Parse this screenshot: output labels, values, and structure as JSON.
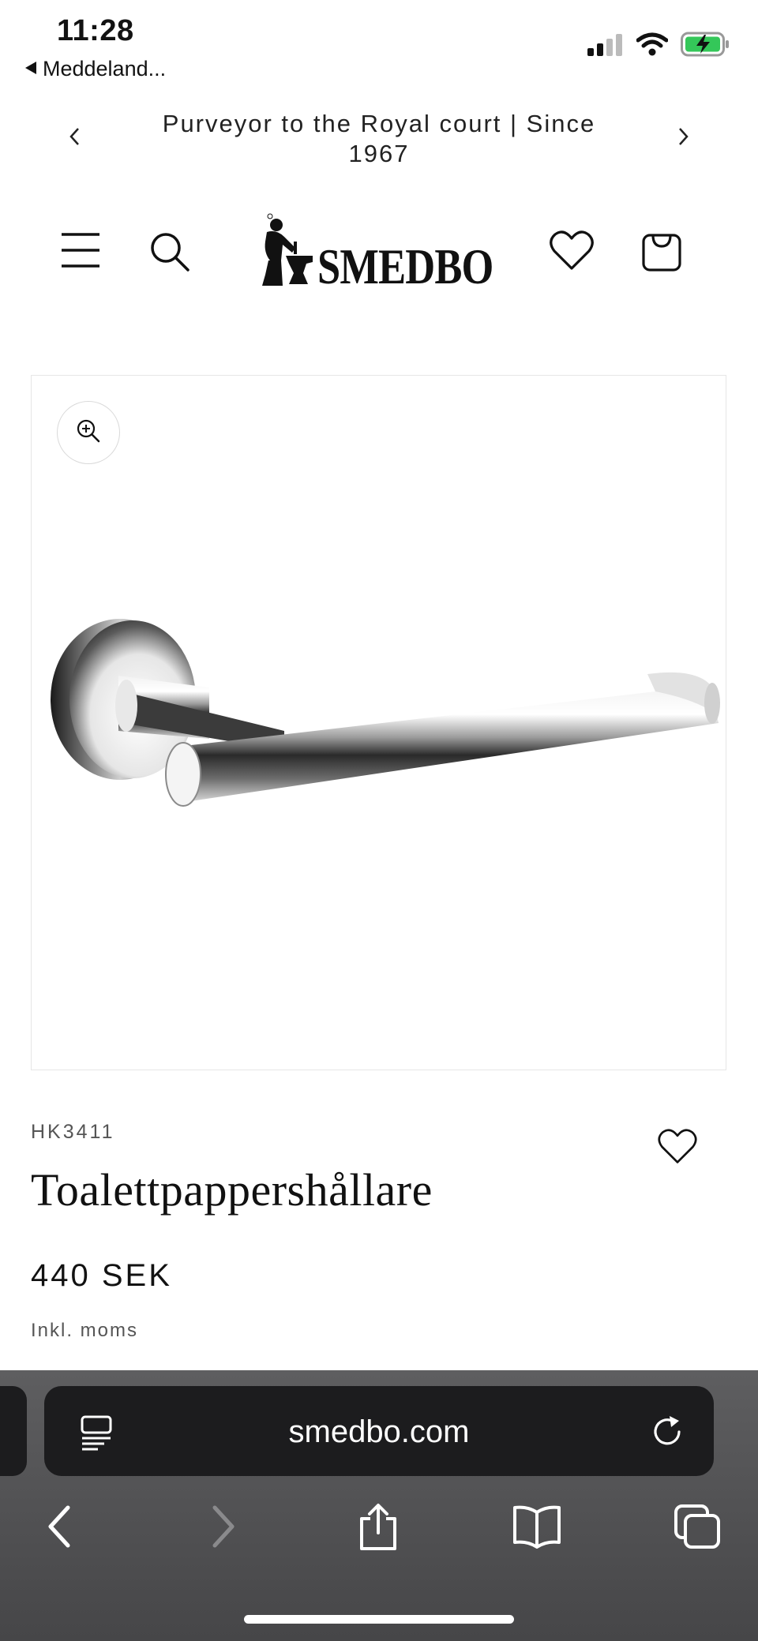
{
  "status_bar": {
    "time": "11:28",
    "back_app": "Meddeland..."
  },
  "announcement": {
    "text": "Purveyor to the Royal court | Since 1967"
  },
  "header": {
    "brand": "SMEDBO"
  },
  "product": {
    "sku": "HK3411",
    "title": "Toalettpappershållare",
    "price": "440 SEK",
    "tax_note": "Inkl. moms"
  },
  "browser": {
    "url": "smedbo.com"
  },
  "icons": {
    "signal": "cellular-signal-icon",
    "wifi": "wifi-icon",
    "battery": "battery-charging-icon",
    "menu": "hamburger-menu-icon",
    "search": "search-icon",
    "wishlist": "heart-icon",
    "cart": "shopping-bag-icon",
    "zoom": "zoom-in-icon"
  },
  "colors": {
    "battery_green": "#34c759",
    "chrome_bg": "#5e5e60",
    "urlbar_bg": "#1c1c1e"
  }
}
